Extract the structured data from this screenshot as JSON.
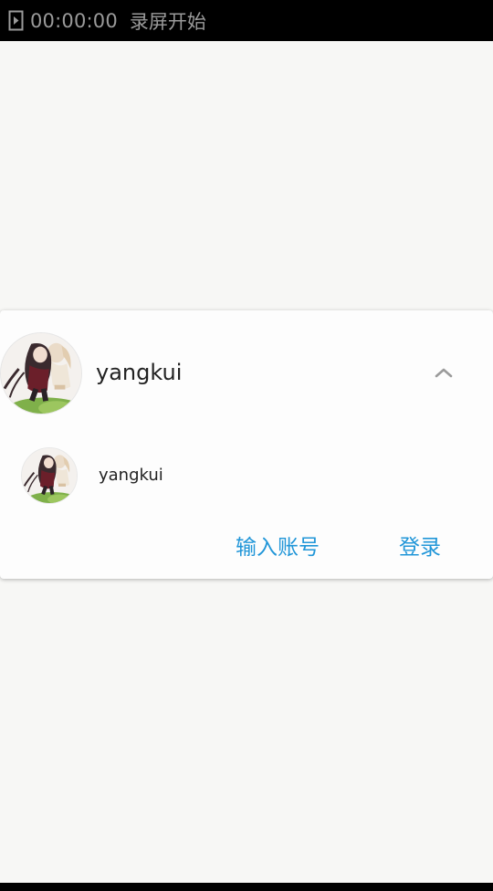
{
  "status_bar": {
    "timer": "00:00:00",
    "recording_text": "录屏开始",
    "icon": "play-box-icon"
  },
  "account_card": {
    "current_account": {
      "username": "yangkui",
      "avatar": "anime-avatar-icon",
      "toggle_icon": "chevron-up-icon"
    },
    "saved_accounts": [
      {
        "username": "yangkui",
        "avatar": "anime-avatar-icon"
      }
    ],
    "actions": {
      "enter_account_label": "输入账号",
      "login_label": "登录"
    }
  },
  "colors": {
    "accent": "#2196d8",
    "background": "#f7f7f5",
    "card": "#fdfdfd",
    "status_bar": "#000000",
    "status_text": "#9a9a9a"
  }
}
